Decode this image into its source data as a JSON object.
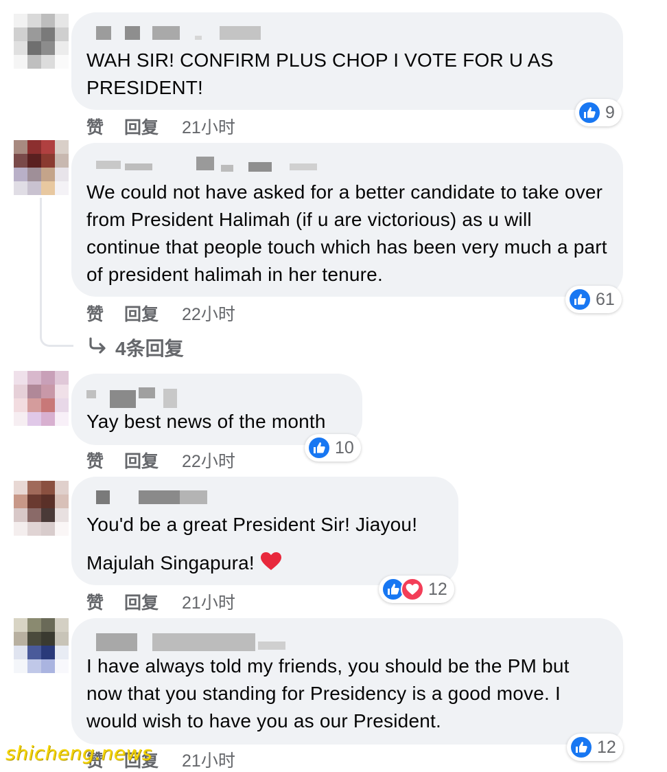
{
  "actions": {
    "like": "赞",
    "reply": "回复"
  },
  "colors": {
    "like_blue": "#1877f2",
    "love_red": "#f33e58",
    "bubble": "#f0f2f5",
    "meta_gray": "#65676b"
  },
  "comments": [
    {
      "text": "WAH SIR! CONFIRM PLUS CHOP I VOTE FOR U AS PRESIDENT!",
      "time": "21小时",
      "reactions": [
        "like-icon"
      ],
      "count": "9"
    },
    {
      "text": "We could not have asked for a better candidate to take over from President Halimah (if u are victorious) as u will continue that people touch which has been very much a part of president halimah in her tenure.",
      "time": "22小时",
      "reactions": [
        "like-icon"
      ],
      "count": "61",
      "replies_label": "4条回复"
    },
    {
      "text": "Yay best news of the month",
      "time": "22小时",
      "reactions": [
        "like-icon"
      ],
      "count": "10"
    },
    {
      "text_line1": "You'd be a great President Sir! Jiayou!",
      "text_line2": "Majulah Singapura!",
      "emoji": "heart-emoji",
      "time": "21小时",
      "reactions": [
        "like-icon",
        "love-icon"
      ],
      "count": "12"
    },
    {
      "text": "I have always told my friends, you should be the PM but now that you standing for Presidency is a good move. I would wish to have you as our President.",
      "time": "21小时",
      "reactions": [
        "like-icon"
      ],
      "count": "12"
    }
  ],
  "watermark": "shicheng.news"
}
